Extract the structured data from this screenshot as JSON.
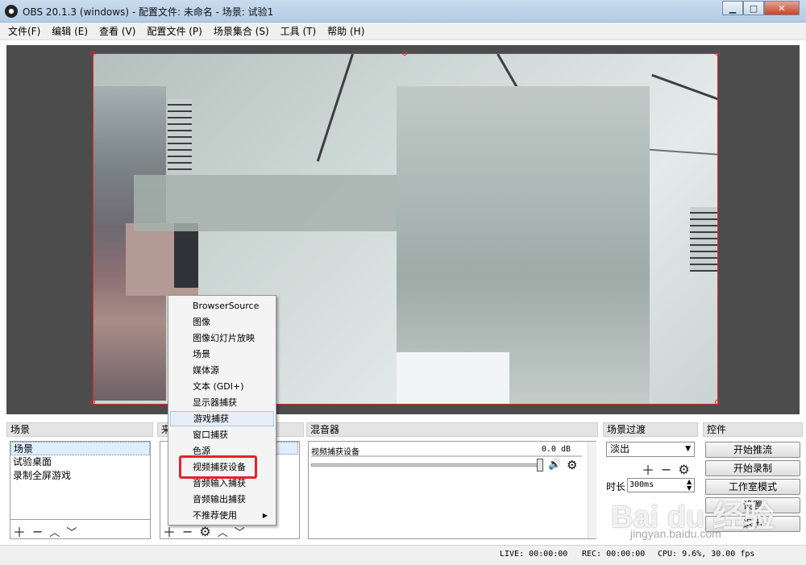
{
  "window": {
    "title": "OBS 20.1.3 (windows) - 配置文件: 未命名 - 场景: 试验1",
    "minimize": "▁",
    "maximize": "□",
    "close": "✕"
  },
  "menu": [
    "文件(F)",
    "编辑 (E)",
    "查看 (V)",
    "配置文件 (P)",
    "场景集合 (S)",
    "工具 (T)",
    "帮助 (H)"
  ],
  "docks": {
    "scenes": {
      "title": "场景",
      "items": [
        "场景",
        "试验桌面",
        "录制全屏游戏"
      ]
    },
    "sources": {
      "title": "来"
    },
    "mixer": {
      "title": "混音器",
      "device": "视频捕获设备",
      "db": "0.0 dB"
    },
    "transitions": {
      "title": "场景过渡",
      "selected": "淡出",
      "duration_label": "时长",
      "duration_value": "300ms"
    },
    "controls": {
      "title": "控件",
      "buttons": [
        "开始推流",
        "开始录制",
        "工作室模式",
        "设置",
        "退出"
      ]
    }
  },
  "context_menu": {
    "items": [
      "BrowserSource",
      "图像",
      "图像幻灯片放映",
      "场景",
      "媒体源",
      "文本 (GDI+)",
      "显示器捕获",
      "游戏捕获",
      "窗口捕获",
      "色源",
      "视频捕获设备",
      "音频输入捕获",
      "音频输出捕获",
      "不推荐使用"
    ],
    "hovered_index": 7,
    "highlighted_index": 10
  },
  "status": {
    "live": "LIVE: 00:00:00",
    "rec": "REC: 00:00:00",
    "cpu": "CPU: 9.6%, 30.00 fps"
  },
  "watermark": {
    "main": "Bai du 经验",
    "sub": "jingyan.baidu.com"
  },
  "colors": {
    "selection_red": "#e0262b",
    "preview_bg": "#4c4c4c"
  }
}
